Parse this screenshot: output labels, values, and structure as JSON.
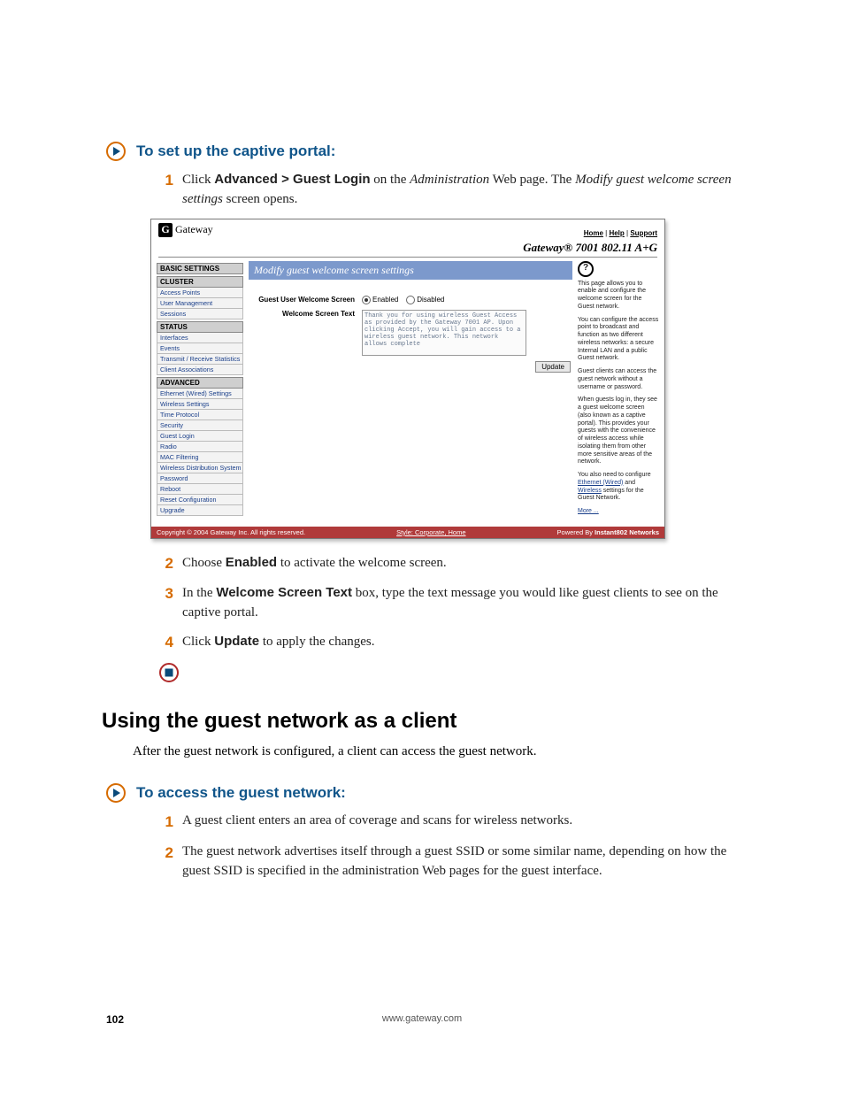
{
  "proc1": {
    "title": "To set up the captive portal:",
    "steps": [
      {
        "num": "1",
        "pre": "Click ",
        "bold": "Advanced > Guest Login",
        "mid": " on the ",
        "ital": "Administration",
        "post": " Web page. The ",
        "ital2": "Modify guest welcome screen settings",
        "post2": " screen opens."
      },
      {
        "num": "2",
        "pre": "Choose ",
        "bold": "Enabled",
        "post": " to activate the welcome screen."
      },
      {
        "num": "3",
        "pre": "In the ",
        "bold": "Welcome Screen Text",
        "post": " box, type the text message you would like guest clients to see on the captive portal."
      },
      {
        "num": "4",
        "pre": "Click ",
        "bold": "Update",
        "post": " to apply the changes."
      }
    ]
  },
  "section_h1": "Using the guest network as a client",
  "section_p": "After the guest network is configured, a client can access the guest network.",
  "proc2": {
    "title": "To access the guest network:",
    "steps": [
      {
        "num": "1",
        "text": "A guest client enters an area of coverage and scans for wireless networks."
      },
      {
        "num": "2",
        "text": "The guest network advertises itself through a guest SSID or some similar name, depending on how the guest SSID is specified in the administration Web pages for the guest interface."
      }
    ]
  },
  "shot": {
    "brand": "Gateway",
    "toplinks": [
      "Home",
      "Help",
      "Support"
    ],
    "model": "Gateway® 7001 802.11 A+G",
    "sidebar": {
      "groups": [
        {
          "header": "BASIC SETTINGS",
          "items": []
        },
        {
          "header": "CLUSTER",
          "items": [
            "Access Points",
            "User Management",
            "Sessions"
          ]
        },
        {
          "header": "STATUS",
          "items": [
            "Interfaces",
            "Events",
            "Transmit / Receive Statistics",
            "Client Associations"
          ]
        },
        {
          "header": "ADVANCED",
          "items": [
            "Ethernet (Wired) Settings",
            "Wireless Settings",
            "Time Protocol",
            "Security",
            "Guest Login",
            "Radio",
            "MAC Filtering",
            "Wireless Distribution System",
            "Password",
            "Reboot",
            "Reset Configuration",
            "Upgrade"
          ]
        }
      ]
    },
    "main": {
      "title": "Modify guest welcome screen settings",
      "row1_label": "Guest User Welcome Screen",
      "enabled": "Enabled",
      "disabled": "Disabled",
      "row2_label": "Welcome Screen Text",
      "textarea": "Thank you for using wireless Guest Access as provided by the Gateway 7001 AP. Upon clicking Accept, you will gain access to a wireless guest network. This network allows complete",
      "update": "Update"
    },
    "help": {
      "p1": "This page allows you to enable and configure the welcome screen for the Guest network.",
      "p2": "You can configure the access point to broadcast and function as two different wireless networks: a secure Internal LAN and a public Guest network.",
      "p3": "Guest clients can access the guest network without a username or password.",
      "p4a": "When guests log in, they see a guest welcome screen (also known as a captive portal). This provides your guests with the convenience of wireless access while isolating them from other more sensitive areas of the network.",
      "p5a": "You also need to configure ",
      "l1": "Ethernet (Wired)",
      "p5b": " and ",
      "l2": "Wireless",
      "p5c": " settings for the Guest Network.",
      "more": "More ..."
    },
    "footer": {
      "left": "Copyright © 2004 Gateway Inc. All rights reserved.",
      "mid": "Style: Corporate, Home",
      "right_pre": "Powered By ",
      "right_b": "Instant802 Networks"
    }
  },
  "footer": {
    "page": "102",
    "url": "www.gateway.com"
  }
}
